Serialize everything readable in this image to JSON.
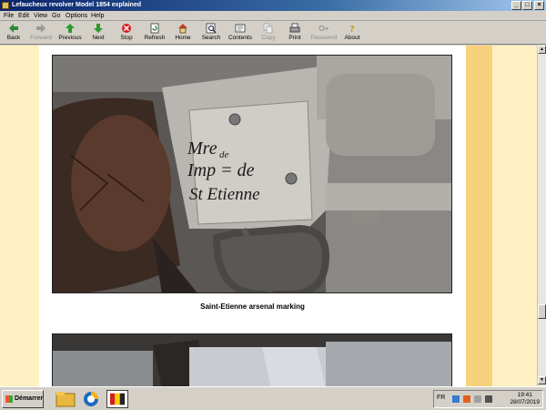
{
  "window": {
    "title": "Lefaucheux revolver Model 1854 explained"
  },
  "menu": [
    "File",
    "Edit",
    "View",
    "Go",
    "Options",
    "Help"
  ],
  "toolbar": [
    {
      "label": "Back",
      "icon": "back-arrow-icon",
      "enabled": true
    },
    {
      "label": "Forward",
      "icon": "forward-arrow-icon",
      "enabled": false
    },
    {
      "label": "Previous",
      "icon": "up-arrow-icon",
      "enabled": true
    },
    {
      "label": "Next",
      "icon": "down-arrow-icon",
      "enabled": true
    },
    {
      "label": "Stop",
      "icon": "stop-icon",
      "enabled": true
    },
    {
      "label": "Refresh",
      "icon": "refresh-icon",
      "enabled": true
    },
    {
      "label": "Home",
      "icon": "home-icon",
      "enabled": true
    },
    {
      "label": "Search",
      "icon": "search-icon",
      "enabled": true
    },
    {
      "label": "Contents",
      "icon": "contents-icon",
      "enabled": true
    },
    {
      "label": "Copy",
      "icon": "copy-icon",
      "enabled": false
    },
    {
      "label": "Print",
      "icon": "print-icon",
      "enabled": true
    },
    {
      "label": "Password",
      "icon": "key-icon",
      "enabled": false
    },
    {
      "label": "About",
      "icon": "about-icon",
      "enabled": true
    }
  ],
  "page": {
    "caption": "Saint-Etienne arsenal marking",
    "engraving": {
      "line1": "Mre",
      "line2": "Imp = de",
      "line3": "St Etienne",
      "sup1": "de"
    }
  },
  "taskbar": {
    "start_label": "Démarrer",
    "language": "FR",
    "time": "19:41",
    "date": "28/07/2019"
  },
  "colors": {
    "page_bg": "#fff1c4",
    "band": "#f7d27c",
    "title_bar": "#0a246a"
  }
}
